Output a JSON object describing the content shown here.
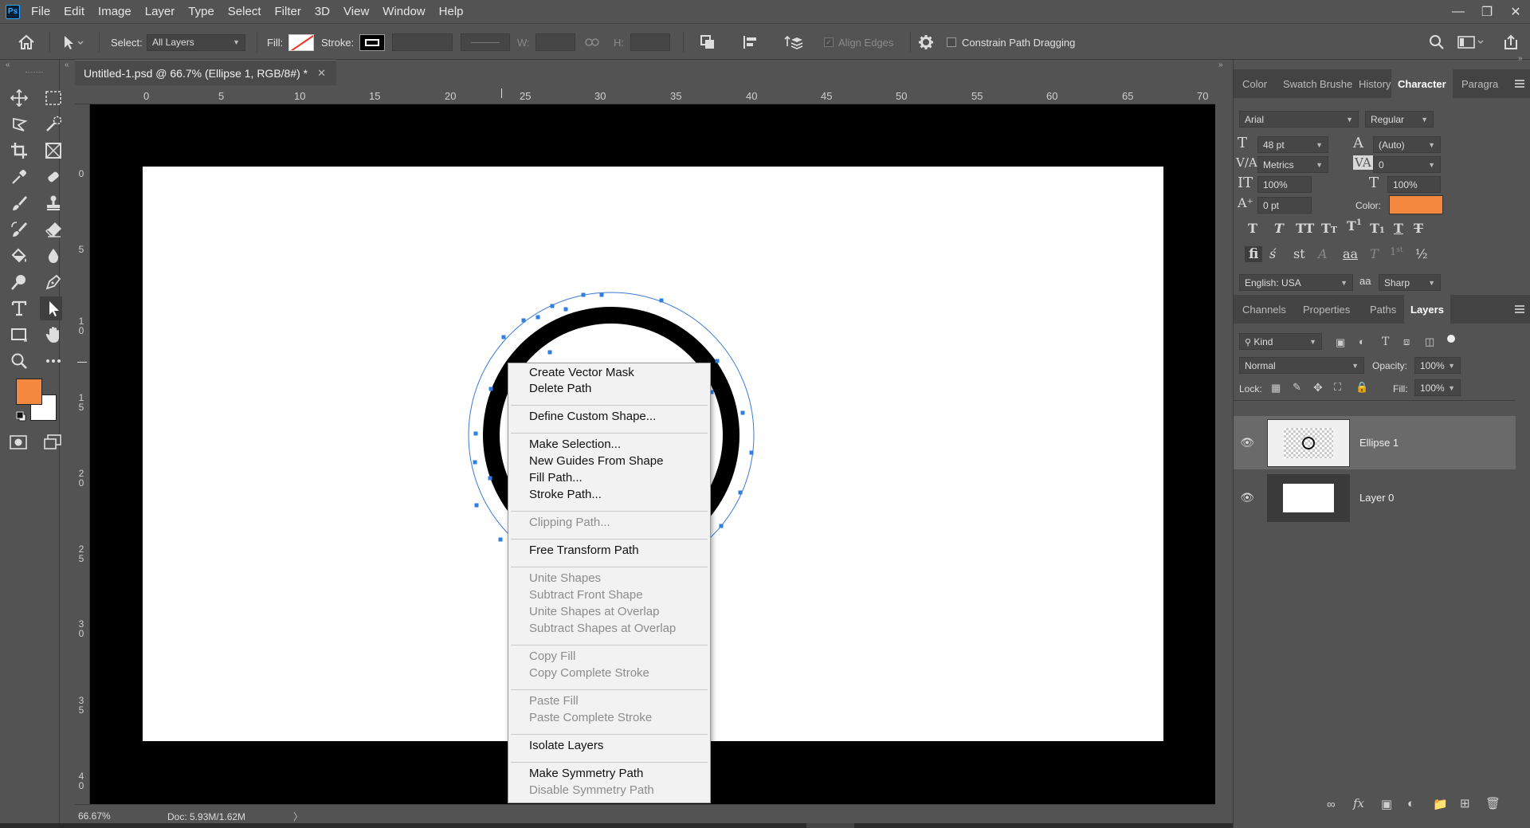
{
  "app": {
    "logo": "Ps"
  },
  "menubar": [
    "File",
    "Edit",
    "Image",
    "Layer",
    "Type",
    "Select",
    "Filter",
    "3D",
    "View",
    "Window",
    "Help"
  ],
  "window_controls": [
    "minimize-icon",
    "restore-icon",
    "close-icon"
  ],
  "options": {
    "select_label": "Select:",
    "select_value": "All Layers",
    "fill_label": "Fill:",
    "stroke_label": "Stroke:",
    "w_label": "W:",
    "h_label": "H:",
    "align_edges": "Align Edges",
    "constrain": "Constrain Path Dragging"
  },
  "document": {
    "tab_title": "Untitled-1.psd @ 66.7% (Ellipse 1, RGB/8#) *",
    "zoom": "66.67%",
    "doc_info": "Doc: 5.93M/1.62M",
    "ruler_h": [
      "0",
      "5",
      "10",
      "15",
      "20",
      "25",
      "30",
      "35",
      "40",
      "45",
      "50",
      "55",
      "60",
      "65",
      "70"
    ],
    "ruler_v": [
      "0",
      "5",
      "1\n0",
      "1\n5",
      "2\n0",
      "2\n5",
      "3\n0",
      "3\n5",
      "4\n0"
    ]
  },
  "context_menu": {
    "groups": [
      [
        {
          "label": "Create Vector Mask",
          "enabled": true
        },
        {
          "label": "Delete Path",
          "enabled": true
        }
      ],
      [
        {
          "label": "Define Custom Shape...",
          "enabled": true
        }
      ],
      [
        {
          "label": "Make Selection...",
          "enabled": true
        },
        {
          "label": "New Guides From Shape",
          "enabled": true
        },
        {
          "label": "Fill Path...",
          "enabled": true
        },
        {
          "label": "Stroke Path...",
          "enabled": true
        }
      ],
      [
        {
          "label": "Clipping Path...",
          "enabled": false
        }
      ],
      [
        {
          "label": "Free Transform Path",
          "enabled": true
        }
      ],
      [
        {
          "label": "Unite Shapes",
          "enabled": false
        },
        {
          "label": "Subtract Front Shape",
          "enabled": false
        },
        {
          "label": "Unite Shapes at Overlap",
          "enabled": false
        },
        {
          "label": "Subtract Shapes at Overlap",
          "enabled": false
        }
      ],
      [
        {
          "label": "Copy Fill",
          "enabled": false
        },
        {
          "label": "Copy Complete Stroke",
          "enabled": false
        }
      ],
      [
        {
          "label": "Paste Fill",
          "enabled": false
        },
        {
          "label": "Paste Complete Stroke",
          "enabled": false
        }
      ],
      [
        {
          "label": "Isolate Layers",
          "enabled": true
        }
      ],
      [
        {
          "label": "Make Symmetry Path",
          "enabled": true
        },
        {
          "label": "Disable Symmetry Path",
          "enabled": false
        }
      ]
    ]
  },
  "top_tabs": [
    "Color",
    "Swatch",
    "Brushe",
    "History",
    "Character",
    "Paragra"
  ],
  "character": {
    "font": "Arial",
    "style": "Regular",
    "size": "48 pt",
    "leading": "(Auto)",
    "kerning": "Metrics",
    "tracking": "0",
    "vscale": "100%",
    "hscale": "100%",
    "baseline": "0 pt",
    "color_label": "Color:",
    "color": "#f4883f",
    "language": "English: USA",
    "aa_label": "aa",
    "antialias": "Sharp"
  },
  "bottom_tabs": [
    "Channels",
    "Properties",
    "Paths",
    "Layers"
  ],
  "layers_panel": {
    "kind": "Kind",
    "blend": "Normal",
    "opacity_label": "Opacity:",
    "opacity": "100%",
    "lock_label": "Lock:",
    "fill_label": "Fill:",
    "fill": "100%",
    "layers": [
      {
        "name": "Ellipse 1",
        "selected": true
      },
      {
        "name": "Layer 0",
        "selected": false
      }
    ]
  },
  "colors": {
    "foreground": "#f4883f",
    "background": "#ffffff",
    "path": "#2f7fe0"
  }
}
